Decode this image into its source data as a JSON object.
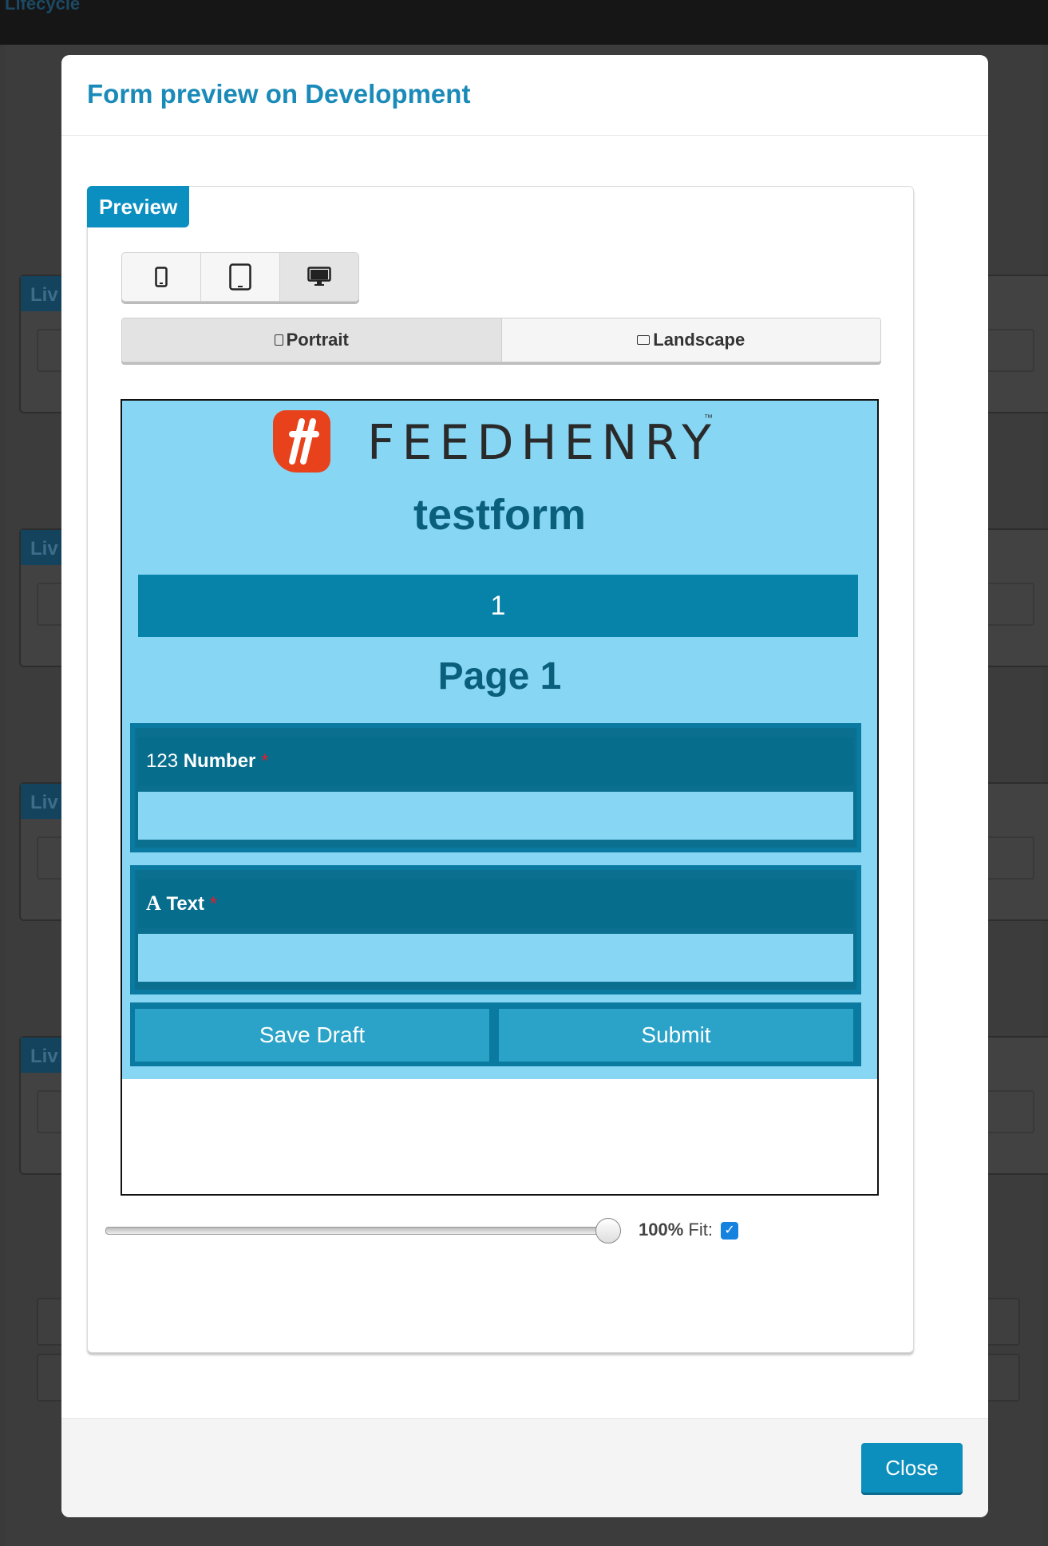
{
  "background": {
    "breadcrumb": "Lifecycle",
    "panel_tag": "Liv"
  },
  "modal": {
    "title": "Form preview on Development",
    "close_label": "Close"
  },
  "preview": {
    "tag": "Preview",
    "devices": [
      {
        "name": "phone",
        "icon": "phone-icon"
      },
      {
        "name": "tablet",
        "icon": "tablet-icon"
      },
      {
        "name": "desktop",
        "icon": "desktop-icon",
        "selected": true
      }
    ],
    "orientation": {
      "portrait_label": "Portrait",
      "landscape_label": "Landscape",
      "selected": "Portrait"
    },
    "zoom": {
      "value": "100%",
      "fit_label": "Fit:",
      "fit_checked": true,
      "slider_fraction": 1.0
    }
  },
  "form": {
    "brand": "FEEDHENRY",
    "brand_tm": "™",
    "title": "testform",
    "page_number": "1",
    "page_title": "Page 1",
    "fields": [
      {
        "icon_text": "123",
        "label": "Number",
        "required_mark": "*"
      },
      {
        "icon_text": "A",
        "label": "Text",
        "required_mark": "*"
      }
    ],
    "save_draft_label": "Save Draft",
    "submit_label": "Submit"
  },
  "colors": {
    "accent": "#0a8fc0",
    "form_bg": "#87d6f3",
    "form_dark": "#066d8d",
    "required": "#e31e2b",
    "logo": "#e8421c"
  }
}
